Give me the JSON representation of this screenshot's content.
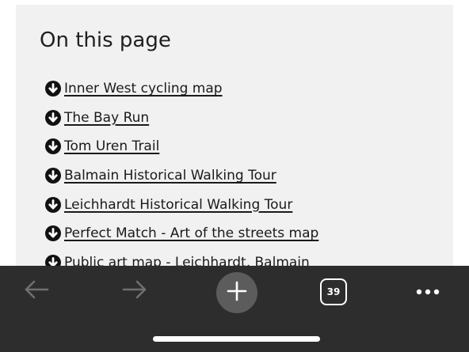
{
  "page": {
    "title": "On this page",
    "links": [
      {
        "label": "Inner West cycling map",
        "icon": "arrow-down-circle-icon"
      },
      {
        "label": "The Bay Run",
        "icon": "arrow-down-circle-icon"
      },
      {
        "label": "Tom Uren Trail",
        "icon": "arrow-down-circle-icon"
      },
      {
        "label": "Balmain Historical Walking Tour",
        "icon": "arrow-down-circle-icon"
      },
      {
        "label": "Leichhardt Historical Walking Tour",
        "icon": "arrow-down-circle-icon"
      },
      {
        "label": "Perfect Match - Art of the streets map",
        "icon": "arrow-down-circle-icon"
      },
      {
        "label": "Public art map - Leichhardt, Balmain",
        "icon": "arrow-down-circle-icon"
      }
    ]
  },
  "browser_toolbar": {
    "back_icon": "back-arrow-icon",
    "forward_icon": "forward-arrow-icon",
    "new_tab_icon": "plus-icon",
    "tab_count": "39",
    "more_icon": "more-dots-icon",
    "background_color": "#2d2d2d",
    "disabled_icon_color": "#6f6f6f"
  },
  "colors": {
    "panel_background": "#f1f1f1",
    "link_text": "#1a1a1a"
  }
}
